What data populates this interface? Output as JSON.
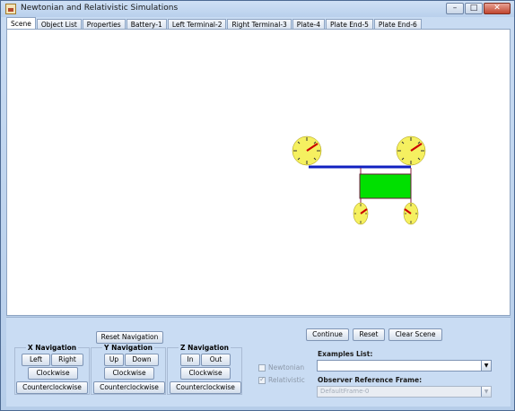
{
  "window": {
    "title": "Newtonian and Relativistic Simulations",
    "minimize": "–",
    "maximize": "□",
    "close": "✕"
  },
  "tabs": [
    {
      "label": "Scene",
      "active": true
    },
    {
      "label": "Object List"
    },
    {
      "label": "Properties"
    },
    {
      "label": "Battery-1"
    },
    {
      "label": "Left Terminal-2"
    },
    {
      "label": "Right Terminal-3"
    },
    {
      "label": "Plate-4"
    },
    {
      "label": "Plate End-5"
    },
    {
      "label": "Plate End-6"
    }
  ],
  "scene": {
    "colors": {
      "wire": "#1020c0",
      "plate": "#00e000",
      "clock_face": "#f5f060",
      "clock_hand": "#cc0000"
    }
  },
  "controls": {
    "reset_navigation": "Reset Navigation",
    "x_nav": {
      "title": "X Navigation",
      "left": "Left",
      "right": "Right",
      "cw": "Clockwise",
      "ccw": "Counterclockwise"
    },
    "y_nav": {
      "title": "Y Navigation",
      "up": "Up",
      "down": "Down",
      "cw": "Clockwise",
      "ccw": "Counterclockwise"
    },
    "z_nav": {
      "title": "Z Navigation",
      "in": "In",
      "out": "Out",
      "cw": "Clockwise",
      "ccw": "Counterclockwise"
    },
    "newtonian": {
      "label": "Newtonian",
      "checked": false
    },
    "relativistic": {
      "label": "Relativistic",
      "checked": true
    },
    "continue": "Continue",
    "reset": "Reset",
    "clear_scene": "Clear Scene",
    "examples_label": "Examples List:",
    "examples_value": "",
    "observer_label": "Observer Reference Frame:",
    "observer_value": "DefaultFrame-0"
  }
}
